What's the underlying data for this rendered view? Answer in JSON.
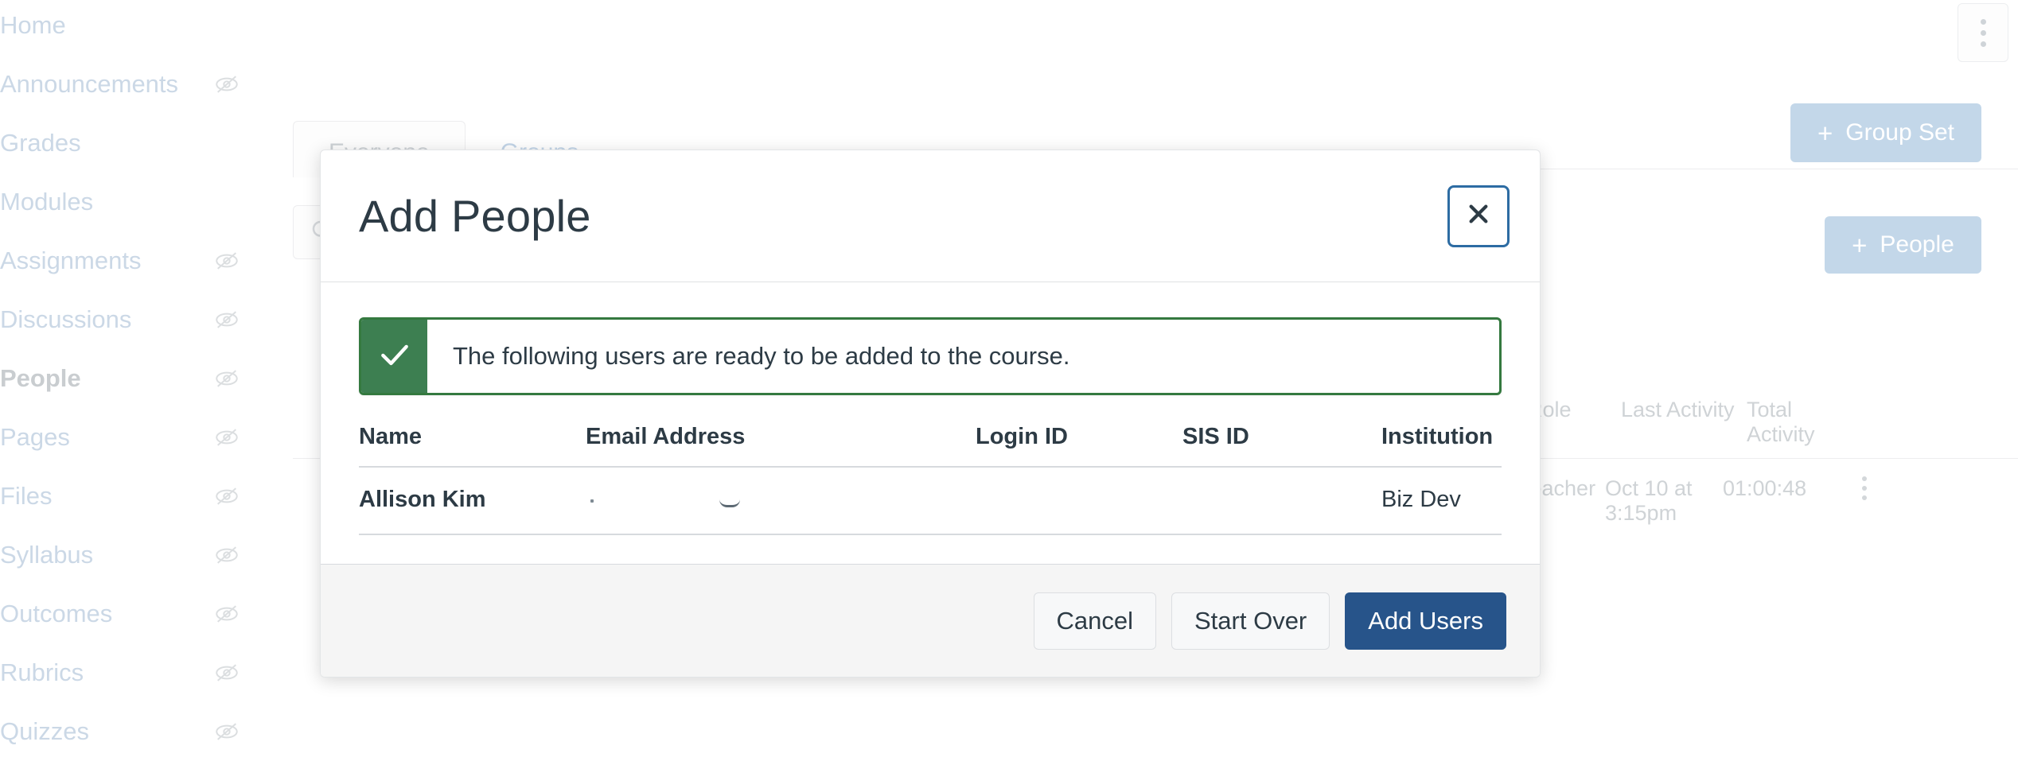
{
  "background": {
    "course_nav": {
      "items": [
        {
          "label": "Home",
          "hidden_icon": false,
          "active": false
        },
        {
          "label": "Announcements",
          "hidden_icon": true,
          "active": false
        },
        {
          "label": "Grades",
          "hidden_icon": false,
          "active": false
        },
        {
          "label": "Modules",
          "hidden_icon": false,
          "active": false
        },
        {
          "label": "Assignments",
          "hidden_icon": true,
          "active": false
        },
        {
          "label": "Discussions",
          "hidden_icon": true,
          "active": false
        },
        {
          "label": "People",
          "hidden_icon": true,
          "active": true
        },
        {
          "label": "Pages",
          "hidden_icon": true,
          "active": false
        },
        {
          "label": "Files",
          "hidden_icon": true,
          "active": false
        },
        {
          "label": "Syllabus",
          "hidden_icon": true,
          "active": false
        },
        {
          "label": "Outcomes",
          "hidden_icon": true,
          "active": false
        },
        {
          "label": "Rubrics",
          "hidden_icon": true,
          "active": false
        },
        {
          "label": "Quizzes",
          "hidden_icon": true,
          "active": false
        }
      ]
    },
    "page_kebab_icon": "kebab-menu-icon",
    "actions": {
      "group_set_label": "Group Set",
      "people_label": "People",
      "plus_glyph": "+"
    },
    "tabs": [
      {
        "label": "Everyone",
        "active": true
      },
      {
        "label": "Groups",
        "active": false
      }
    ],
    "search": {
      "placeholder": "",
      "value": "",
      "icon": "search-icon"
    },
    "roster": {
      "headers": [
        "Role",
        "Last Activity",
        "Total Activity"
      ],
      "rows": [
        {
          "role": "Teacher",
          "last_activity": "Oct 10 at 3:15pm",
          "total_activity": "01:00:48"
        }
      ]
    }
  },
  "modal": {
    "title": "Add People",
    "close_icon": "close-icon",
    "alert": {
      "icon": "check-icon",
      "message": "The following users are ready to be added to the course.",
      "accent_color": "#3d7f51",
      "border_color": "#34793f"
    },
    "table": {
      "headers": [
        "Name",
        "Email Address",
        "Login ID",
        "SIS ID",
        "Institution"
      ],
      "rows": [
        {
          "name": "Allison Kim",
          "email": "",
          "login_id": "",
          "sis_id": "",
          "institution": "Biz Dev"
        }
      ]
    },
    "footer": {
      "cancel_label": "Cancel",
      "start_over_label": "Start Over",
      "add_users_label": "Add Users",
      "primary_color": "#27548a"
    }
  }
}
